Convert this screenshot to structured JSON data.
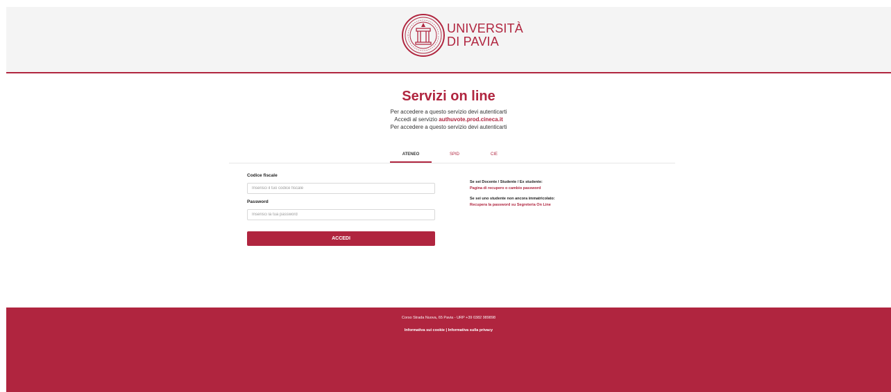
{
  "header": {
    "logo_line1": "UNIVERSITÀ",
    "logo_line2": "DI PAVIA"
  },
  "intro": {
    "title": "Servizi on line",
    "line1": "Per accedere a questo servizio devi autenticarti",
    "line2_prefix": "Accedi al servizio ",
    "line2_service": "authuvote.prod.cineca.it",
    "line3": "Per accedere a questo servizio devi autenticarti"
  },
  "tabs": [
    {
      "label": "ATENEO",
      "active": true
    },
    {
      "label": "SPID",
      "active": false
    },
    {
      "label": "CIE",
      "active": false
    }
  ],
  "form": {
    "codice_label": "Codice fiscale",
    "codice_placeholder": "Inserisci il tuo codice fiscale",
    "codice_value": "",
    "password_label": "Password",
    "password_placeholder": "Inserisci la tua password",
    "password_value": "",
    "submit_label": "ACCEDI"
  },
  "help": {
    "q1": "Se sei Docente / Studente / Ex studente:",
    "link1": "Pagina di recupero o cambio password",
    "q2": "Se sei uno studente non ancora immatricolato:",
    "link2": "Recupera la password su Segreteria On Line"
  },
  "footer": {
    "address": "Corso Strada Nuova, 65 Pavia - URP +39 0382 989898",
    "cookie_link": "Informativa sui cookie",
    "separator": " | ",
    "privacy_link": "Informativa sulla privacy"
  },
  "colors": {
    "brand": "#b0253f",
    "header_bg": "#f4f4f4",
    "text": "#333333"
  }
}
